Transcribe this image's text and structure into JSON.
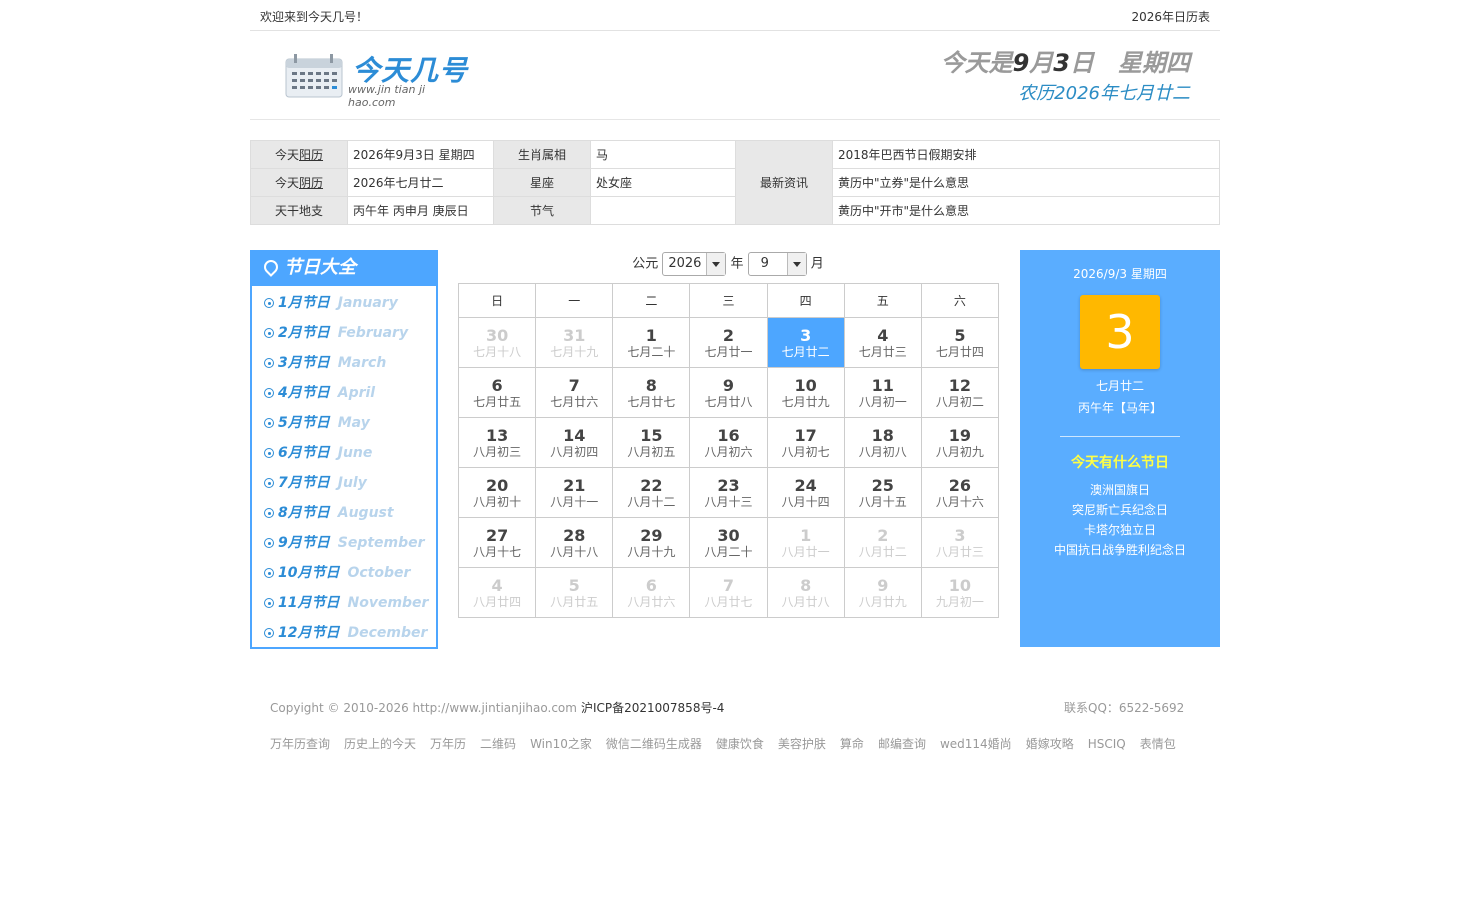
{
  "topbar": {
    "welcome": "欢迎来到今天几号！",
    "year_calendar": "2026年日历表"
  },
  "logo": {
    "brand": "今天几号",
    "url": "www.jin tian ji hao.com"
  },
  "today": {
    "prefix": "今天是",
    "month_num": "9",
    "month_unit": "月",
    "day_num": "3",
    "day_unit": "日",
    "weekday": "星期四",
    "lunar": "农历2026年七月廿二"
  },
  "info": {
    "solar_label_pre": "今天",
    "solar_label_link": "阳历",
    "solar_value": "2026年9月3日 星期四",
    "lunar_label_pre": "今天",
    "lunar_label_link": "阴历",
    "lunar_value": "2026年七月廿二",
    "ganzhi_label": "天干地支",
    "ganzhi_value": "丙午年 丙申月 庚辰日",
    "zodiac_label": "生肖属相",
    "zodiac_value": "马",
    "constellation_label": "星座",
    "constellation_value": "处女座",
    "solar_term_label": "节气",
    "solar_term_value": "",
    "news_label": "最新资讯",
    "news": [
      "2018年巴西节日假期安排",
      "黄历中\"立券\"是什么意思",
      "黄历中\"开市\"是什么意思"
    ]
  },
  "sidebar": {
    "title": "节日大全",
    "items": [
      {
        "cn": "1月节日",
        "en": "January"
      },
      {
        "cn": "2月节日",
        "en": "February"
      },
      {
        "cn": "3月节日",
        "en": "March"
      },
      {
        "cn": "4月节日",
        "en": "April"
      },
      {
        "cn": "5月节日",
        "en": "May"
      },
      {
        "cn": "6月节日",
        "en": "June"
      },
      {
        "cn": "7月节日",
        "en": "July"
      },
      {
        "cn": "8月节日",
        "en": "August"
      },
      {
        "cn": "9月节日",
        "en": "September"
      },
      {
        "cn": "10月节日",
        "en": "October"
      },
      {
        "cn": "11月节日",
        "en": "November"
      },
      {
        "cn": "12月节日",
        "en": "December"
      }
    ]
  },
  "calendar": {
    "era_label": "公元",
    "year_value": "2026",
    "year_label": "年",
    "month_value": "9",
    "month_label": "月",
    "weekdays": [
      "日",
      "一",
      "二",
      "三",
      "四",
      "五",
      "六"
    ],
    "weeks": [
      [
        {
          "d": "30",
          "n": "七月十八",
          "o": true
        },
        {
          "d": "31",
          "n": "七月十九",
          "o": true
        },
        {
          "d": "1",
          "n": "七月二十"
        },
        {
          "d": "2",
          "n": "七月廿一"
        },
        {
          "d": "3",
          "n": "七月廿二",
          "cur": true
        },
        {
          "d": "4",
          "n": "七月廿三"
        },
        {
          "d": "5",
          "n": "七月廿四"
        }
      ],
      [
        {
          "d": "6",
          "n": "七月廿五"
        },
        {
          "d": "7",
          "n": "七月廿六"
        },
        {
          "d": "8",
          "n": "七月廿七"
        },
        {
          "d": "9",
          "n": "七月廿八"
        },
        {
          "d": "10",
          "n": "七月廿九"
        },
        {
          "d": "11",
          "n": "八月初一"
        },
        {
          "d": "12",
          "n": "八月初二"
        }
      ],
      [
        {
          "d": "13",
          "n": "八月初三"
        },
        {
          "d": "14",
          "n": "八月初四"
        },
        {
          "d": "15",
          "n": "八月初五"
        },
        {
          "d": "16",
          "n": "八月初六"
        },
        {
          "d": "17",
          "n": "八月初七"
        },
        {
          "d": "18",
          "n": "八月初八"
        },
        {
          "d": "19",
          "n": "八月初九"
        }
      ],
      [
        {
          "d": "20",
          "n": "八月初十"
        },
        {
          "d": "21",
          "n": "八月十一"
        },
        {
          "d": "22",
          "n": "八月十二"
        },
        {
          "d": "23",
          "n": "八月十三"
        },
        {
          "d": "24",
          "n": "八月十四"
        },
        {
          "d": "25",
          "n": "八月十五"
        },
        {
          "d": "26",
          "n": "八月十六"
        }
      ],
      [
        {
          "d": "27",
          "n": "八月十七"
        },
        {
          "d": "28",
          "n": "八月十八"
        },
        {
          "d": "29",
          "n": "八月十九"
        },
        {
          "d": "30",
          "n": "八月二十"
        },
        {
          "d": "1",
          "n": "八月廿一",
          "o": true
        },
        {
          "d": "2",
          "n": "八月廿二",
          "o": true
        },
        {
          "d": "3",
          "n": "八月廿三",
          "o": true
        }
      ],
      [
        {
          "d": "4",
          "n": "八月廿四",
          "o": true
        },
        {
          "d": "5",
          "n": "八月廿五",
          "o": true
        },
        {
          "d": "6",
          "n": "八月廿六",
          "o": true
        },
        {
          "d": "7",
          "n": "八月廿七",
          "o": true
        },
        {
          "d": "8",
          "n": "八月廿八",
          "o": true
        },
        {
          "d": "9",
          "n": "八月廿九",
          "o": true
        },
        {
          "d": "10",
          "n": "九月初一",
          "o": true
        }
      ]
    ]
  },
  "panel": {
    "date": "2026/9/3 星期四",
    "big_day": "3",
    "lunar": "七月廿二",
    "ganzhi": "丙午年【马年】",
    "festival_heading": "今天有什么节日",
    "festivals": [
      "澳洲国旗日",
      "突尼斯亡兵纪念日",
      "卡塔尔独立日",
      "中国抗日战争胜利纪念日"
    ]
  },
  "footer": {
    "copyright": "Copyight © 2010-2026 http://www.jintianjihao.com",
    "icp": "沪ICP备2021007858号-4",
    "qq": "联系QQ：6522-5692",
    "links": [
      "万年历查询",
      "历史上的今天",
      "万年历",
      "二维码",
      "Win10之家",
      "微信二维码生成器",
      "健康饮食",
      "美容护肤",
      "算命",
      "邮编查询",
      "wed114婚尚",
      "婚嫁攻略",
      "HSCIQ",
      "表情包"
    ]
  },
  "colors": {
    "accent": "#4da6ff",
    "brand": "#2c8cd6",
    "highlight": "#ffb800",
    "festival_heading": "#ffff44"
  }
}
